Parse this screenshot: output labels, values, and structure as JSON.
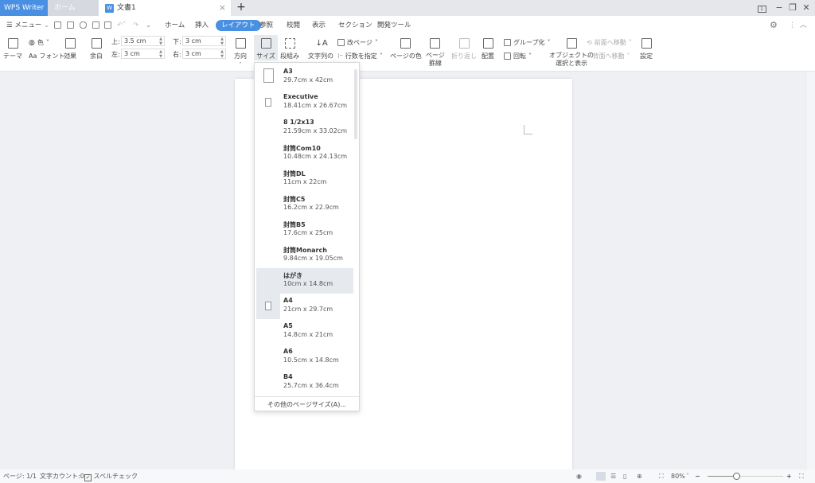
{
  "titlebar": {
    "app_name": "WPS Writer",
    "home_tab": "ホーム",
    "doc_tab": "文書1",
    "doc_icon": "W",
    "close_glyph": "×",
    "new_tab_glyph": "+",
    "window_badge": "1"
  },
  "menubar": {
    "menu_label": "メニュー",
    "tabs": [
      "ホーム",
      "挿入",
      "レイアウト",
      "参照",
      "校閲",
      "表示",
      "セクション",
      "開発ツール"
    ],
    "active_tab": "レイアウト"
  },
  "ribbon": {
    "theme": "テーマ",
    "color": "色",
    "font": "フォント",
    "effects": "効果",
    "margins": "余白",
    "margin_top_label": "上:",
    "margin_top_value": "3.5 cm",
    "margin_left_label": "左:",
    "margin_left_value": "3 cm",
    "margin_bottom_label": "下:",
    "margin_bottom_value": "3 cm",
    "margin_right_label": "右:",
    "margin_right_value": "3 cm",
    "orientation": "方向",
    "size": "サイズ",
    "columns": "段組み",
    "text_direction": "文字列の",
    "page_break": "改ページ",
    "line_numbers": "行数を指定",
    "page_color": "ページの色",
    "page_border_1": "ページ",
    "page_border_2": "罫線",
    "wrap": "折り返し",
    "align": "配置",
    "group": "グループ化",
    "rotate": "回転",
    "selection_pane_1": "オブジェクトの",
    "selection_pane_2": "選択と表示",
    "bring_forward": "前面へ移動",
    "send_backward": "背面へ移動",
    "settings": "設定"
  },
  "size_dropdown": {
    "items": [
      {
        "name": "A3",
        "size": "29.7cm x 42cm"
      },
      {
        "name": "Executive",
        "size": "18.41cm x 26.67cm"
      },
      {
        "name": "8 1/2x13",
        "size": "21.59cm x 33.02cm"
      },
      {
        "name": "封筒Com10",
        "size": "10.48cm x 24.13cm"
      },
      {
        "name": "封筒DL",
        "size": "11cm x 22cm"
      },
      {
        "name": "封筒C5",
        "size": "16.2cm x 22.9cm"
      },
      {
        "name": "封筒B5",
        "size": "17.6cm x 25cm"
      },
      {
        "name": "封筒Monarch",
        "size": "9.84cm x 19.05cm"
      },
      {
        "name": "はがき",
        "size": "10cm x 14.8cm"
      },
      {
        "name": "A4",
        "size": "21cm x 29.7cm"
      },
      {
        "name": "A5",
        "size": "14.8cm x 21cm"
      },
      {
        "name": "A6",
        "size": "10.5cm x 14.8cm"
      },
      {
        "name": "B4",
        "size": "25.7cm x 36.4cm"
      }
    ],
    "hovered": "はがき",
    "selected": "A4",
    "more_sizes": "その他のページサイズ(A)..."
  },
  "statusbar": {
    "page": "ページ: 1/1",
    "word_count": "文字カウント:0",
    "spell_check": "スペルチェック",
    "zoom": "80%",
    "zoom_fraction": 0.8,
    "zoom_minus": "−",
    "zoom_plus": "+"
  },
  "colors": {
    "accent": "#4a90e2",
    "hover": "#e6e9ee",
    "canvas": "#eef0f4"
  }
}
